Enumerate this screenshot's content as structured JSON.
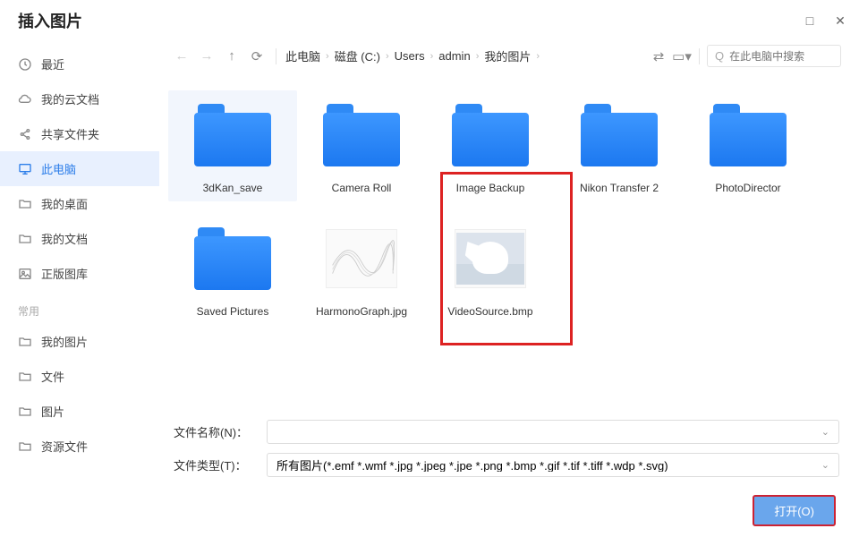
{
  "title": "插入图片",
  "winControls": {
    "maximize": "□",
    "close": "✕"
  },
  "sidebar": {
    "items": [
      {
        "icon": "clock",
        "label": "最近"
      },
      {
        "icon": "cloud",
        "label": "我的云文档"
      },
      {
        "icon": "share",
        "label": "共享文件夹"
      },
      {
        "icon": "monitor",
        "label": "此电脑",
        "active": true
      },
      {
        "icon": "folder",
        "label": "我的桌面"
      },
      {
        "icon": "folder",
        "label": "我的文档"
      },
      {
        "icon": "image",
        "label": "正版图库"
      }
    ],
    "frequentLabel": "常用",
    "frequent": [
      {
        "icon": "folder",
        "label": "我的图片"
      },
      {
        "icon": "folder",
        "label": "文件"
      },
      {
        "icon": "folder",
        "label": "图片"
      },
      {
        "icon": "folder",
        "label": "资源文件"
      }
    ]
  },
  "breadcrumbs": [
    "此电脑",
    "磁盘 (C:)",
    "Users",
    "admin",
    "我的图片"
  ],
  "search": {
    "placeholder": "在此电脑中搜索"
  },
  "files": [
    {
      "type": "folder",
      "label": "3dKan_save",
      "selected": true
    },
    {
      "type": "folder",
      "label": "Camera Roll"
    },
    {
      "type": "folder",
      "label": "Image Backup"
    },
    {
      "type": "folder",
      "label": "Nikon Transfer 2"
    },
    {
      "type": "folder",
      "label": "PhotoDirector"
    },
    {
      "type": "folder",
      "label": "Saved Pictures"
    },
    {
      "type": "wave",
      "label": "HarmonoGraph.jpg"
    },
    {
      "type": "swan",
      "label": "VideoSource.bmp"
    }
  ],
  "form": {
    "filenameLabel": "文件名称(N)：",
    "filenameValue": "",
    "filetypeLabel": "文件类型(T)：",
    "filetypeValue": "所有图片(*.emf *.wmf *.jpg *.jpeg *.jpe *.png *.bmp *.gif *.tif *.tiff *.wdp *.svg)"
  },
  "actions": {
    "open": "打开(O)"
  }
}
